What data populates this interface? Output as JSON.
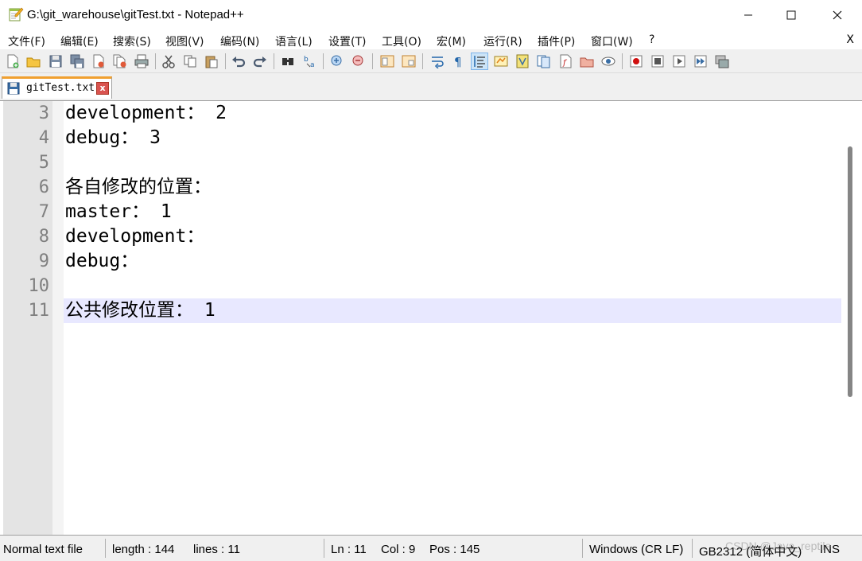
{
  "window": {
    "title": "G:\\git_warehouse\\gitTest.txt - Notepad++",
    "icon": "notepad-pencil-icon",
    "minimize_label": "—",
    "maximize_label": "☐",
    "close_label": "✕"
  },
  "menu": {
    "items": [
      "文件(F)",
      "编辑(E)",
      "搜索(S)",
      "视图(V)",
      "编码(N)",
      "语言(L)",
      "设置(T)",
      "工具(O)",
      "宏(M)",
      "运行(R)",
      "插件(P)",
      "窗口(W)",
      "?"
    ],
    "close_label": "X"
  },
  "toolbar": {
    "icons": [
      "new-file-icon",
      "open-file-icon",
      "save-icon",
      "save-all-icon",
      "close-icon",
      "close-all-icon",
      "print-icon",
      "cut-icon",
      "copy-icon",
      "paste-icon",
      "undo-icon",
      "redo-icon",
      "find-icon",
      "replace-icon",
      "zoom-in-icon",
      "zoom-out-icon",
      "sync-vertical-icon",
      "sync-horizontal-icon",
      "word-wrap-icon",
      "show-all-chars-icon",
      "indent-guide-icon",
      "user-language-icon",
      "document-map-icon",
      "document-list-icon",
      "function-list-icon",
      "folder-workspace-icon",
      "monitoring-icon",
      "record-macro-icon",
      "stop-macro-icon",
      "play-macro-icon",
      "run-macro-multiple-icon",
      "save-macro-icon"
    ]
  },
  "tab": {
    "label": "gitTest.txt",
    "close_label": "x",
    "accent_color": "#f0a030"
  },
  "editor": {
    "lines": [
      {
        "num": "3",
        "text": "development： 2"
      },
      {
        "num": "4",
        "text": "debug： 3"
      },
      {
        "num": "5",
        "text": ""
      },
      {
        "num": "6",
        "text": "各自修改的位置："
      },
      {
        "num": "7",
        "text": "master： 1"
      },
      {
        "num": "8",
        "text": "development："
      },
      {
        "num": "9",
        "text": "debug："
      },
      {
        "num": "10",
        "text": ""
      },
      {
        "num": "11",
        "text": "公共修改位置： 1"
      }
    ],
    "current_line": "11",
    "current_line_color": "#e8e8ff"
  },
  "status": {
    "file_type": "Normal text file",
    "length": "length : 144",
    "lines": "lines : 11",
    "ln": "Ln : 11",
    "col": "Col : 9",
    "pos": "Pos : 145",
    "eol": "Windows (CR LF)",
    "encoding": "GB2312 (简体中文)",
    "mode": "INS",
    "watermark": "CSDN @Java_reptile"
  }
}
